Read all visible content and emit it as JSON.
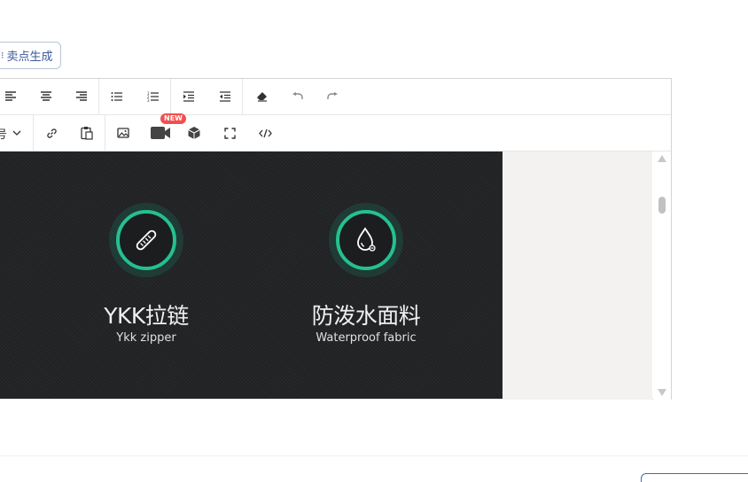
{
  "sell_button": {
    "icon": "bolt-icon",
    "label": "卖点生成"
  },
  "toolbar": {
    "row1": [
      "align-left-icon",
      "align-center-icon",
      "align-right-icon",
      "bullet-list-icon",
      "numbered-list-icon",
      "indent-icon",
      "outdent-icon",
      "clear-format-icon",
      "undo-icon",
      "redo-icon"
    ],
    "row2": {
      "heading_fragment": "号",
      "icons": [
        "link-icon",
        "paste-icon",
        "image-icon",
        "video-icon",
        "3d-model-icon",
        "fullscreen-icon",
        "code-view-icon"
      ],
      "new_badge": "NEW"
    }
  },
  "content": {
    "features": [
      {
        "icon": "zipper-icon",
        "title": "YKK拉链",
        "subtitle": "Ykk zipper"
      },
      {
        "icon": "water-drop-icon",
        "title": "防泼水面料",
        "subtitle": "Waterproof fabric"
      }
    ]
  },
  "colors": {
    "accent_green": "#25c08f",
    "banner_bg": "#222426",
    "badge_red": "#f05050",
    "link_blue": "#3a5a9a"
  }
}
